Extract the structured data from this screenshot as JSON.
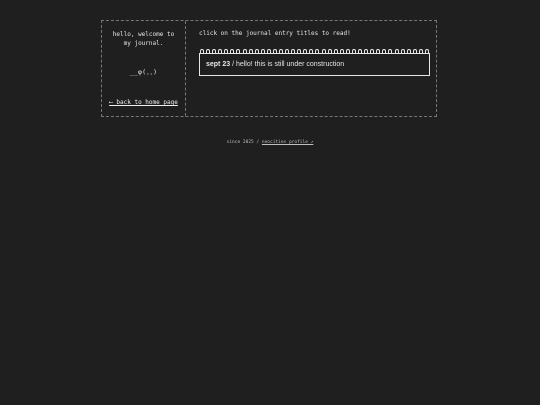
{
  "sidebar": {
    "greeting": "hello, welcome to\nmy journal.",
    "kaomoji": "__φ(．．)",
    "back_link": "⟵ back to home page"
  },
  "main": {
    "instructions": "click on the journal entry titles to read!",
    "entries": [
      {
        "date": "sept 23",
        "separator": " / ",
        "title": "hello! this is still under construction"
      }
    ]
  },
  "footer": {
    "since": "since 2025",
    "separator": " / ",
    "link": "neocities profile ↗"
  }
}
